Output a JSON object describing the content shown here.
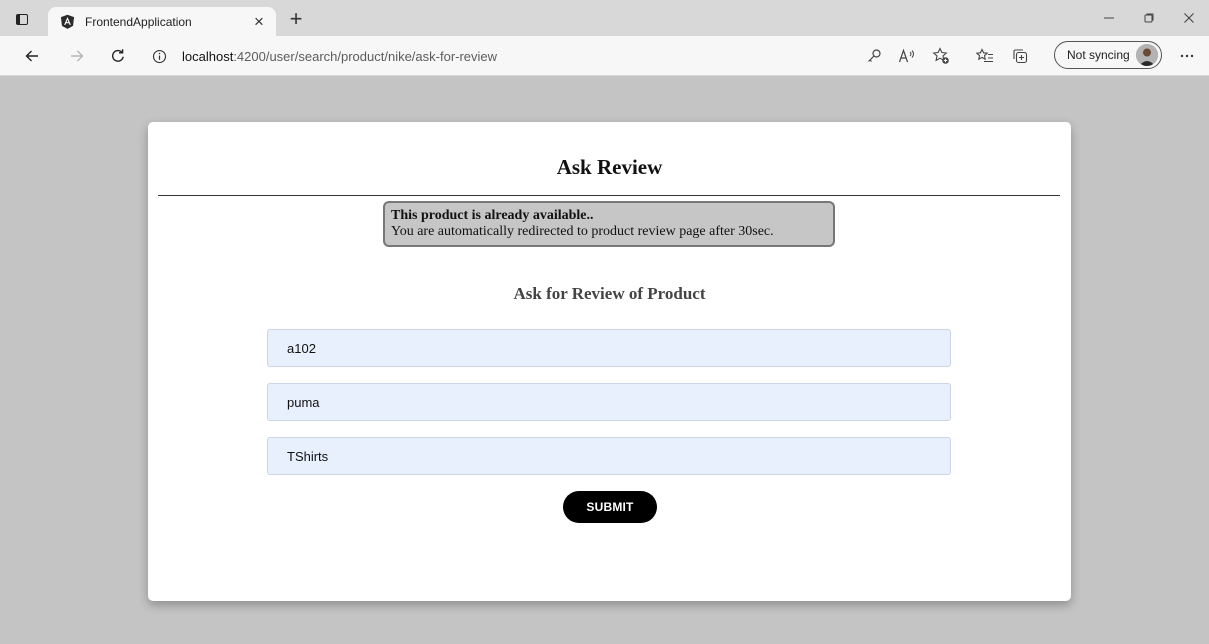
{
  "browser": {
    "tab_title": "FrontendApplication",
    "tab_close": "×",
    "new_tab": "+",
    "address_host": "localhost",
    "address_path": ":4200/user/search/product/nike/ask-for-review",
    "sync_label": "Not syncing",
    "icons": [
      "tab-actions-icon",
      "angular-favicon-icon",
      "back-icon",
      "forward-icon",
      "refresh-icon",
      "site-info-icon",
      "key-icon",
      "read-aloud-icon",
      "add-favorite-icon",
      "favorites-icon",
      "collections-icon",
      "profile-avatar-icon",
      "more-icon",
      "minimize-icon",
      "restore-icon",
      "close-window-icon"
    ]
  },
  "page": {
    "title": "Ask Review",
    "alert": {
      "title": "This product is already available..",
      "message": "You are automatically redirected to product review page after 30sec."
    },
    "form": {
      "title": "Ask for Review of Product",
      "fields": [
        {
          "name": "product-id",
          "value": "a102"
        },
        {
          "name": "brand",
          "value": "puma"
        },
        {
          "name": "category",
          "value": "TShirts"
        }
      ],
      "submit_label": "SUBMIT"
    }
  },
  "colors": {
    "page_background": "#c4c4c4",
    "card_background": "#ffffff",
    "alert_background": "#c6c6c6",
    "input_background": "#e8effd",
    "button_background": "#000000"
  }
}
